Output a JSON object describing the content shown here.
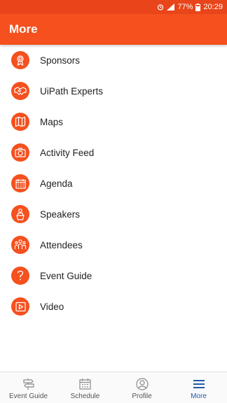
{
  "status_bar": {
    "battery": "77%",
    "time": "20:29"
  },
  "header": {
    "title": "More"
  },
  "menu": {
    "items": [
      {
        "label": "Sponsors",
        "icon": "award-ribbon-icon"
      },
      {
        "label": "UiPath Experts",
        "icon": "handshake-icon"
      },
      {
        "label": "Maps",
        "icon": "map-icon"
      },
      {
        "label": "Activity Feed",
        "icon": "camera-icon"
      },
      {
        "label": "Agenda",
        "icon": "calendar-icon"
      },
      {
        "label": "Speakers",
        "icon": "speaker-podium-icon"
      },
      {
        "label": "Attendees",
        "icon": "people-group-icon"
      },
      {
        "label": "Event Guide",
        "icon": "question-mark-icon"
      },
      {
        "label": "Video",
        "icon": "video-play-icon"
      }
    ]
  },
  "tabs": [
    {
      "label": "Event Guide",
      "icon": "signpost-icon",
      "active": false
    },
    {
      "label": "Schedule",
      "icon": "calendar-icon",
      "active": false
    },
    {
      "label": "Profile",
      "icon": "user-circle-icon",
      "active": false
    },
    {
      "label": "More",
      "icon": "hamburger-menu-icon",
      "active": true
    }
  ],
  "colors": {
    "accent": "#f5501e",
    "status_bar": "#e8451a",
    "active_tab": "#1f5aa6"
  }
}
